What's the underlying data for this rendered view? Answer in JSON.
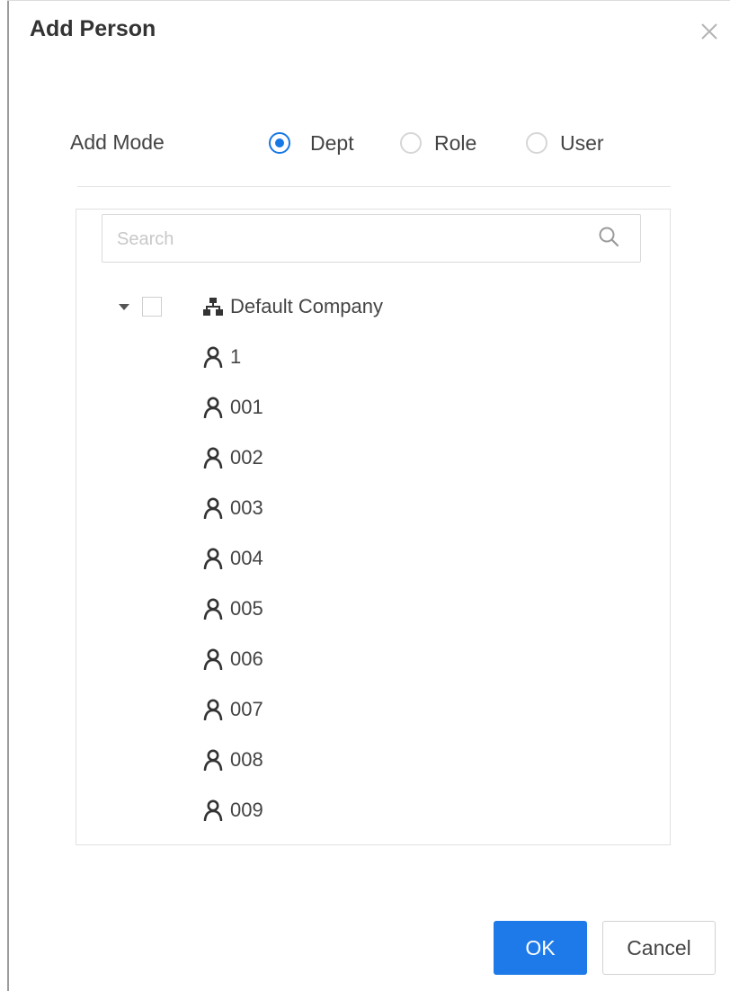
{
  "dialog": {
    "title": "Add Person",
    "close_icon": "close-icon"
  },
  "add_mode": {
    "label": "Add Mode",
    "options": [
      {
        "label": "Dept",
        "selected": true
      },
      {
        "label": "Role",
        "selected": false
      },
      {
        "label": "User",
        "selected": false
      }
    ]
  },
  "search": {
    "placeholder": "Search",
    "value": "",
    "icon": "search-icon"
  },
  "tree": {
    "expanded": true,
    "root": {
      "label": "Default Company",
      "icon": "organization-icon"
    },
    "persons": [
      {
        "label": "1",
        "icon": "person-icon"
      },
      {
        "label": "001",
        "icon": "person-icon"
      },
      {
        "label": "002",
        "icon": "person-icon"
      },
      {
        "label": "003",
        "icon": "person-icon"
      },
      {
        "label": "004",
        "icon": "person-icon"
      },
      {
        "label": "005",
        "icon": "person-icon"
      },
      {
        "label": "006",
        "icon": "person-icon"
      },
      {
        "label": "007",
        "icon": "person-icon"
      },
      {
        "label": "008",
        "icon": "person-icon"
      },
      {
        "label": "009",
        "icon": "person-icon"
      }
    ]
  },
  "footer": {
    "ok_label": "OK",
    "cancel_label": "Cancel"
  },
  "colors": {
    "accent": "#1e7ae8",
    "text": "#444444",
    "border": "#d9d9d9"
  }
}
